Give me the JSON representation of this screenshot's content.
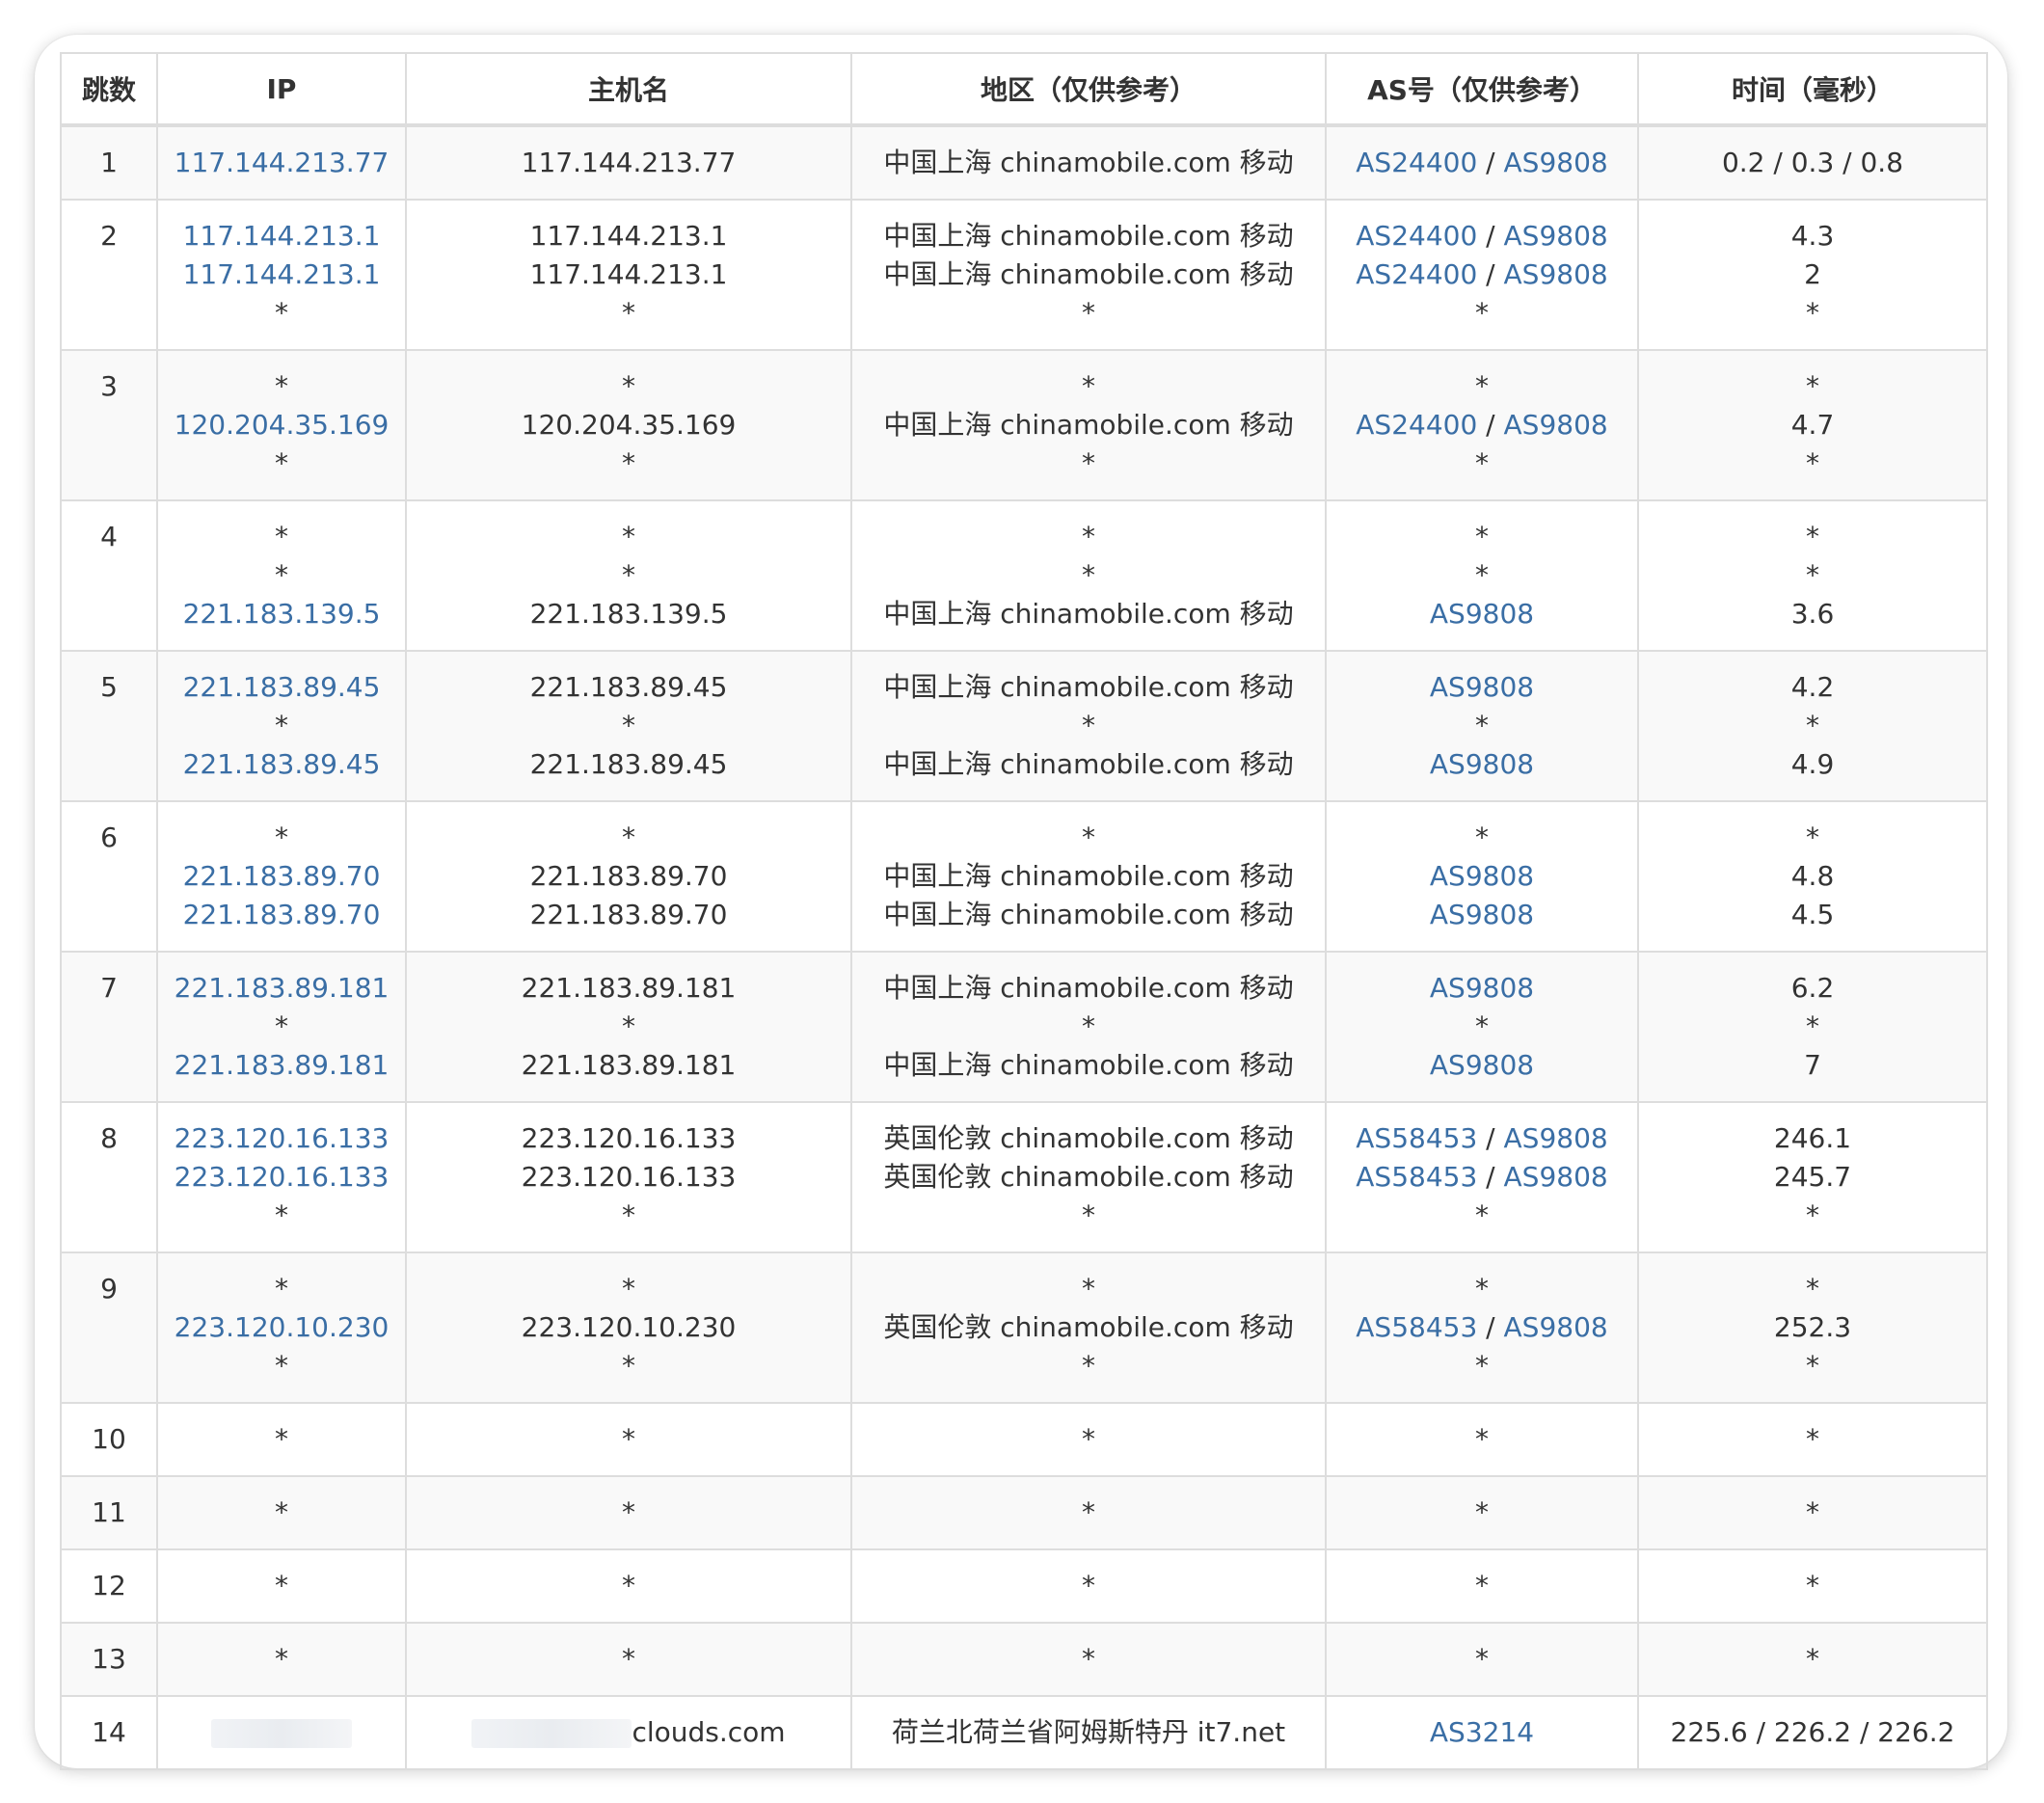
{
  "headers": {
    "hop": "跳数",
    "ip": "IP",
    "host": "主机名",
    "region": "地区（仅供参考）",
    "as": "AS号（仅供参考）",
    "time": "时间（毫秒）"
  },
  "rows": [
    {
      "hop": "1",
      "lines": [
        {
          "ip": "117.144.213.77",
          "host": "117.144.213.77",
          "region": "中国上海 chinamobile.com 移动",
          "as": [
            "AS24400",
            "AS9808"
          ],
          "time": "0.2 / 0.3 / 0.8"
        }
      ]
    },
    {
      "hop": "2",
      "lines": [
        {
          "ip": "117.144.213.1",
          "host": "117.144.213.1",
          "region": "中国上海 chinamobile.com 移动",
          "as": [
            "AS24400",
            "AS9808"
          ],
          "time": "4.3"
        },
        {
          "ip": "117.144.213.1",
          "host": "117.144.213.1",
          "region": "中国上海 chinamobile.com 移动",
          "as": [
            "AS24400",
            "AS9808"
          ],
          "time": "2"
        },
        {
          "ip": "*",
          "host": "*",
          "region": "*",
          "as": "*",
          "time": "*"
        }
      ]
    },
    {
      "hop": "3",
      "lines": [
        {
          "ip": "*",
          "host": "*",
          "region": "*",
          "as": "*",
          "time": "*"
        },
        {
          "ip": "120.204.35.169",
          "host": "120.204.35.169",
          "region": "中国上海 chinamobile.com 移动",
          "as": [
            "AS24400",
            "AS9808"
          ],
          "time": "4.7"
        },
        {
          "ip": "*",
          "host": "*",
          "region": "*",
          "as": "*",
          "time": "*"
        }
      ]
    },
    {
      "hop": "4",
      "lines": [
        {
          "ip": "*",
          "host": "*",
          "region": "*",
          "as": "*",
          "time": "*"
        },
        {
          "ip": "*",
          "host": "*",
          "region": "*",
          "as": "*",
          "time": "*"
        },
        {
          "ip": "221.183.139.5",
          "host": "221.183.139.5",
          "region": "中国上海 chinamobile.com 移动",
          "as": [
            "AS9808"
          ],
          "time": "3.6"
        }
      ]
    },
    {
      "hop": "5",
      "lines": [
        {
          "ip": "221.183.89.45",
          "host": "221.183.89.45",
          "region": "中国上海 chinamobile.com 移动",
          "as": [
            "AS9808"
          ],
          "time": "4.2"
        },
        {
          "ip": "*",
          "host": "*",
          "region": "*",
          "as": "*",
          "time": "*"
        },
        {
          "ip": "221.183.89.45",
          "host": "221.183.89.45",
          "region": "中国上海 chinamobile.com 移动",
          "as": [
            "AS9808"
          ],
          "time": "4.9"
        }
      ]
    },
    {
      "hop": "6",
      "lines": [
        {
          "ip": "*",
          "host": "*",
          "region": "*",
          "as": "*",
          "time": "*"
        },
        {
          "ip": "221.183.89.70",
          "host": "221.183.89.70",
          "region": "中国上海 chinamobile.com 移动",
          "as": [
            "AS9808"
          ],
          "time": "4.8"
        },
        {
          "ip": "221.183.89.70",
          "host": "221.183.89.70",
          "region": "中国上海 chinamobile.com 移动",
          "as": [
            "AS9808"
          ],
          "time": "4.5"
        }
      ]
    },
    {
      "hop": "7",
      "lines": [
        {
          "ip": "221.183.89.181",
          "host": "221.183.89.181",
          "region": "中国上海 chinamobile.com 移动",
          "as": [
            "AS9808"
          ],
          "time": "6.2"
        },
        {
          "ip": "*",
          "host": "*",
          "region": "*",
          "as": "*",
          "time": "*"
        },
        {
          "ip": "221.183.89.181",
          "host": "221.183.89.181",
          "region": "中国上海 chinamobile.com 移动",
          "as": [
            "AS9808"
          ],
          "time": "7"
        }
      ]
    },
    {
      "hop": "8",
      "lines": [
        {
          "ip": "223.120.16.133",
          "host": "223.120.16.133",
          "region": "英国伦敦 chinamobile.com 移动",
          "as": [
            "AS58453",
            "AS9808"
          ],
          "time": "246.1"
        },
        {
          "ip": "223.120.16.133",
          "host": "223.120.16.133",
          "region": "英国伦敦 chinamobile.com 移动",
          "as": [
            "AS58453",
            "AS9808"
          ],
          "time": "245.7"
        },
        {
          "ip": "*",
          "host": "*",
          "region": "*",
          "as": "*",
          "time": "*"
        }
      ]
    },
    {
      "hop": "9",
      "lines": [
        {
          "ip": "*",
          "host": "*",
          "region": "*",
          "as": "*",
          "time": "*"
        },
        {
          "ip": "223.120.10.230",
          "host": "223.120.10.230",
          "region": "英国伦敦 chinamobile.com 移动",
          "as": [
            "AS58453",
            "AS9808"
          ],
          "time": "252.3"
        },
        {
          "ip": "*",
          "host": "*",
          "region": "*",
          "as": "*",
          "time": "*"
        }
      ]
    },
    {
      "hop": "10",
      "lines": [
        {
          "ip": "*",
          "host": "*",
          "region": "*",
          "as": "*",
          "time": "*"
        }
      ]
    },
    {
      "hop": "11",
      "lines": [
        {
          "ip": "*",
          "host": "*",
          "region": "*",
          "as": "*",
          "time": "*"
        }
      ]
    },
    {
      "hop": "12",
      "lines": [
        {
          "ip": "*",
          "host": "*",
          "region": "*",
          "as": "*",
          "time": "*"
        }
      ]
    },
    {
      "hop": "13",
      "lines": [
        {
          "ip": "*",
          "host": "*",
          "region": "*",
          "as": "*",
          "time": "*"
        }
      ]
    },
    {
      "hop": "14",
      "lines": [
        {
          "ip": "",
          "ip_redacted": true,
          "host": "clouds.com",
          "host_redacted": true,
          "region": "荷兰北荷兰省阿姆斯特丹 it7.net",
          "as": [
            "AS3214"
          ],
          "time": "225.6 / 226.2 / 226.2"
        }
      ]
    }
  ]
}
